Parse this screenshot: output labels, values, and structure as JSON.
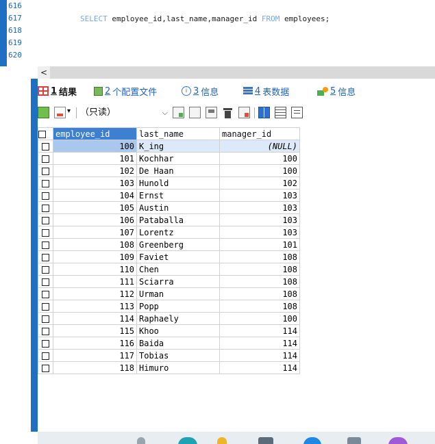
{
  "editor": {
    "lines": [
      {
        "num": "616",
        "code": ""
      },
      {
        "num": "617",
        "code": "SELECT employee_id,last_name,manager_id FROM employees;"
      },
      {
        "num": "618",
        "code": ""
      },
      {
        "num": "619",
        "code": ""
      },
      {
        "num": "620",
        "code": ""
      }
    ],
    "sql": {
      "kw_select": "SELECT",
      "columns": " employee_id,last_name,manager_id ",
      "kw_from": "FROM",
      "table": " employees;"
    }
  },
  "scrollbar": {
    "left_arrow": "<"
  },
  "tabs": [
    {
      "num": "1",
      "label": "结果",
      "icon": "grid-result-icon",
      "active": true
    },
    {
      "num": "2",
      "label": "个配置文件",
      "icon": "profile-icon",
      "active": false
    },
    {
      "num": "3",
      "label": "信息",
      "icon": "info-icon",
      "active": false
    },
    {
      "num": "4",
      "label": "表数据",
      "icon": "table-data-icon",
      "active": false
    },
    {
      "num": "5",
      "label": "信息",
      "icon": "chart-info-icon",
      "active": false
    }
  ],
  "toolbar": {
    "mode": "（只读）",
    "mode_caret": "⌵"
  },
  "grid": {
    "columns": [
      "employee_id",
      "last_name",
      "manager_id"
    ],
    "rows": [
      [
        "100",
        "K_ing",
        "(NULL)"
      ],
      [
        "101",
        "Kochhar",
        "100"
      ],
      [
        "102",
        "De Haan",
        "100"
      ],
      [
        "103",
        "Hunold",
        "102"
      ],
      [
        "104",
        "Ernst",
        "103"
      ],
      [
        "105",
        "Austin",
        "103"
      ],
      [
        "106",
        "Pataballa",
        "103"
      ],
      [
        "107",
        "Lorentz",
        "103"
      ],
      [
        "108",
        "Greenberg",
        "101"
      ],
      [
        "109",
        "Faviet",
        "108"
      ],
      [
        "110",
        "Chen",
        "108"
      ],
      [
        "111",
        "Sciarra",
        "108"
      ],
      [
        "112",
        "Urman",
        "108"
      ],
      [
        "113",
        "Popp",
        "108"
      ],
      [
        "114",
        "Raphaely",
        "100"
      ],
      [
        "115",
        "Khoo",
        "114"
      ],
      [
        "116",
        "Baida",
        "114"
      ],
      [
        "117",
        "Tobias",
        "114"
      ],
      [
        "118",
        "Himuro",
        "114"
      ]
    ]
  },
  "colors": {
    "accent": "#1f6fc2",
    "header_selected": "#3d7fd1",
    "row_selected": "#aac8ee",
    "keyword": "#7aa7ef"
  }
}
